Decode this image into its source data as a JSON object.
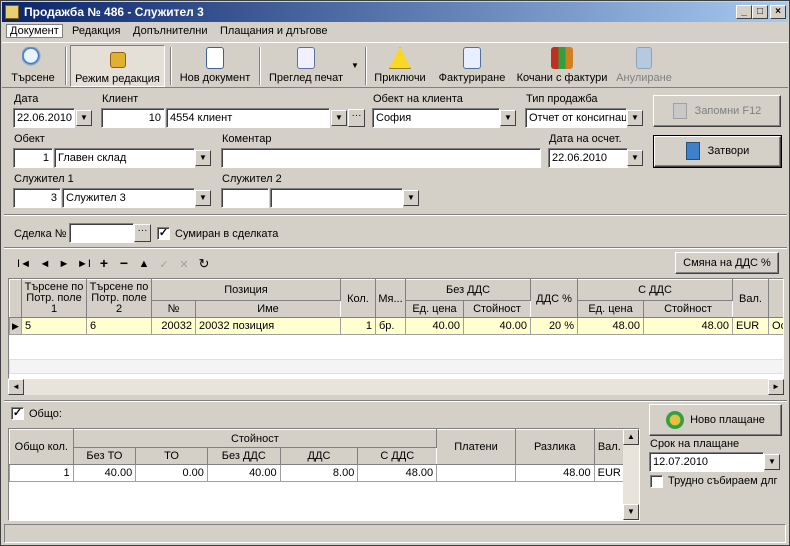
{
  "window": {
    "title": "Продажба № 486 - Служител 3",
    "minimize": "_",
    "maximize": "□",
    "close": "×"
  },
  "menu": [
    "Документ",
    "Редакция",
    "Допълнителни",
    "Плащания и длъгове"
  ],
  "toolbar": {
    "search": "Търсене",
    "edit_mode": "Режим редакция",
    "new_doc": "Нов документ",
    "print_preview": "Преглед печат",
    "finish": "Приключи",
    "invoice": "Фактуриране",
    "invoices_attached": "Кочани с фактури",
    "cancel": "Анулиране"
  },
  "form": {
    "date_label": "Дата",
    "date": "22.06.2010",
    "client_label": "Клиент",
    "client_id": "10",
    "client_name": "4554 клиент",
    "client_object_label": "Обект на клиента",
    "client_object": "София",
    "sale_type_label": "Тип продажба",
    "sale_type": "Отчет от консигнац",
    "save_button": "Запомни  F12",
    "object_label": "Обект",
    "object_id": "1",
    "object_name": "Главен склад",
    "comment_label": "Коментар",
    "comment": "",
    "report_date_label": "Дата на осчет.",
    "report_date": "22.06.2010",
    "close_button": "Затвори",
    "employee1_label": "Служител 1",
    "employee1_id": "3",
    "employee1_name": "Служител 3",
    "employee2_label": "Служител 2",
    "employee2_id": "",
    "employee2_name": ""
  },
  "deal": {
    "label": "Сделка №",
    "value": "",
    "summed_label": "Сумиран в сделката",
    "summed_checked": true
  },
  "nav": {
    "first": "I◄",
    "prev": "◄",
    "next": "►",
    "last": "►I",
    "add": "+",
    "remove": "−",
    "up": "▲",
    "check": "✓",
    "cancel": "✕",
    "refresh": "↻"
  },
  "vat_change_button": "Смяна на ДДС %",
  "items_grid": {
    "headers": {
      "search_field1": "Търсене по Потр. поле 1",
      "search_field2": "Търсене по Потр. поле 2",
      "position": "Позиция",
      "no": "№",
      "name": "Име",
      "qty": "Кол.",
      "unit": "Мя...",
      "without_vat": "Без ДДС",
      "unit_price": "Ед. цена",
      "value": "Стойност",
      "vat_pct": "ДДС %",
      "with_vat": "С ДДС",
      "unit_price2": "Ед. цена",
      "value2": "Стойност",
      "currency": "Вал.",
      "extra": "Ос"
    },
    "rows": [
      {
        "f1": "5",
        "f2": "6",
        "no": "20032",
        "name": "20032 позиция",
        "qty": "1",
        "unit": "бр.",
        "price": "40.00",
        "value": "40.00",
        "vat": "20 %",
        "price_vat": "48.00",
        "value_vat": "48.00",
        "currency": "EUR",
        "extra": "Ос"
      }
    ]
  },
  "totals": {
    "total_label": "Общо:",
    "total_checked": true,
    "headers": {
      "total_qty": "Общо кол.",
      "value": "Стойност",
      "without_to": "Без ТО",
      "to": "ТО",
      "without_vat": "Без ДДС",
      "vat": "ДДС",
      "with_vat": "С ДДС",
      "paid": "Платени",
      "difference": "Разлика",
      "currency": "Вал."
    },
    "row": {
      "total_qty": "1",
      "without_to": "40.00",
      "to": "0.00",
      "without_vat": "40.00",
      "vat": "8.00",
      "with_vat": "48.00",
      "paid": "",
      "difference": "48.00",
      "currency": "EUR"
    }
  },
  "payment": {
    "new_payment_button": "Ново плащане",
    "due_label": "Срок на плащане",
    "due_date": "12.07.2010",
    "hard_collect_label": "Трудно събираем длг",
    "hard_collect_checked": false
  },
  "colors": {
    "title_start": "#0a246a",
    "selected_row": "#ffffd0"
  }
}
